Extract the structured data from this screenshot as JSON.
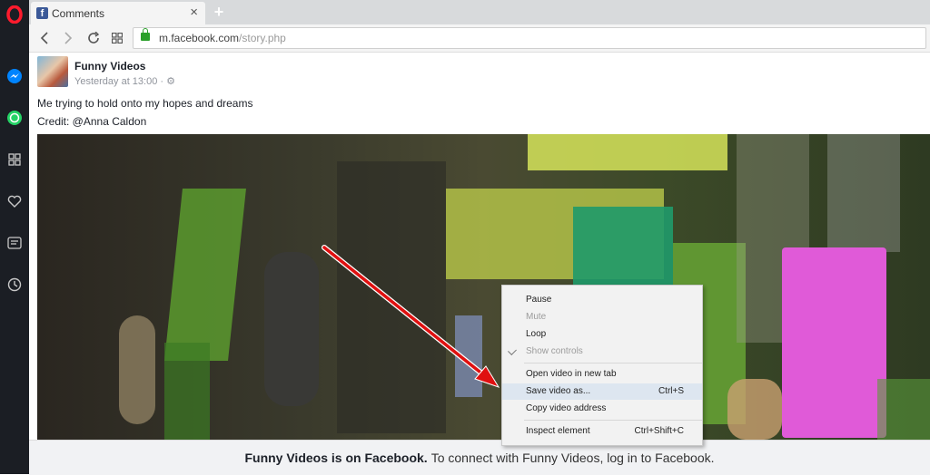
{
  "tab": {
    "title": "Comments",
    "favicon_letter": "f"
  },
  "address": {
    "host": "m.facebook.com",
    "path": "/story.php"
  },
  "post": {
    "page_name": "Funny Videos",
    "time": "Yesterday at 13:00 · ⚙",
    "caption": "Me trying to hold onto my hopes and dreams",
    "credit": "Credit: @Anna Caldon"
  },
  "context_menu": {
    "items": [
      {
        "label": "Pause",
        "shortcut": "",
        "disabled": false
      },
      {
        "label": "Mute",
        "shortcut": "",
        "disabled": true
      },
      {
        "label": "Loop",
        "shortcut": "",
        "disabled": false
      },
      {
        "label": "Show controls",
        "shortcut": "",
        "disabled": true,
        "checked": true
      },
      {
        "label": "Open video in new tab",
        "shortcut": ""
      },
      {
        "label": "Save video as...",
        "shortcut": "Ctrl+S",
        "highlighted": true
      },
      {
        "label": "Copy video address",
        "shortcut": ""
      },
      {
        "label": "Inspect element",
        "shortcut": "Ctrl+Shift+C"
      }
    ]
  },
  "footer": {
    "bold": "Funny Videos is on Facebook.",
    "text": "To connect with Funny Videos, log in to Facebook."
  },
  "colors": {
    "sidebar_bg": "#1b1e24",
    "opera_red": "#ff1b2d",
    "messenger": "#0084ff",
    "whatsapp": "#25d366",
    "facebook_blue": "#3b5998",
    "annotation_arrow": "#e01010"
  },
  "icons": [
    "opera-icon",
    "messenger-icon",
    "whatsapp-icon",
    "speed-dial-icon",
    "heart-icon",
    "news-icon",
    "history-icon",
    "back-icon",
    "forward-icon",
    "reload-icon",
    "tabs-grid-icon",
    "lock-icon",
    "close-icon",
    "new-tab-icon",
    "check-icon",
    "settings-icon"
  ]
}
